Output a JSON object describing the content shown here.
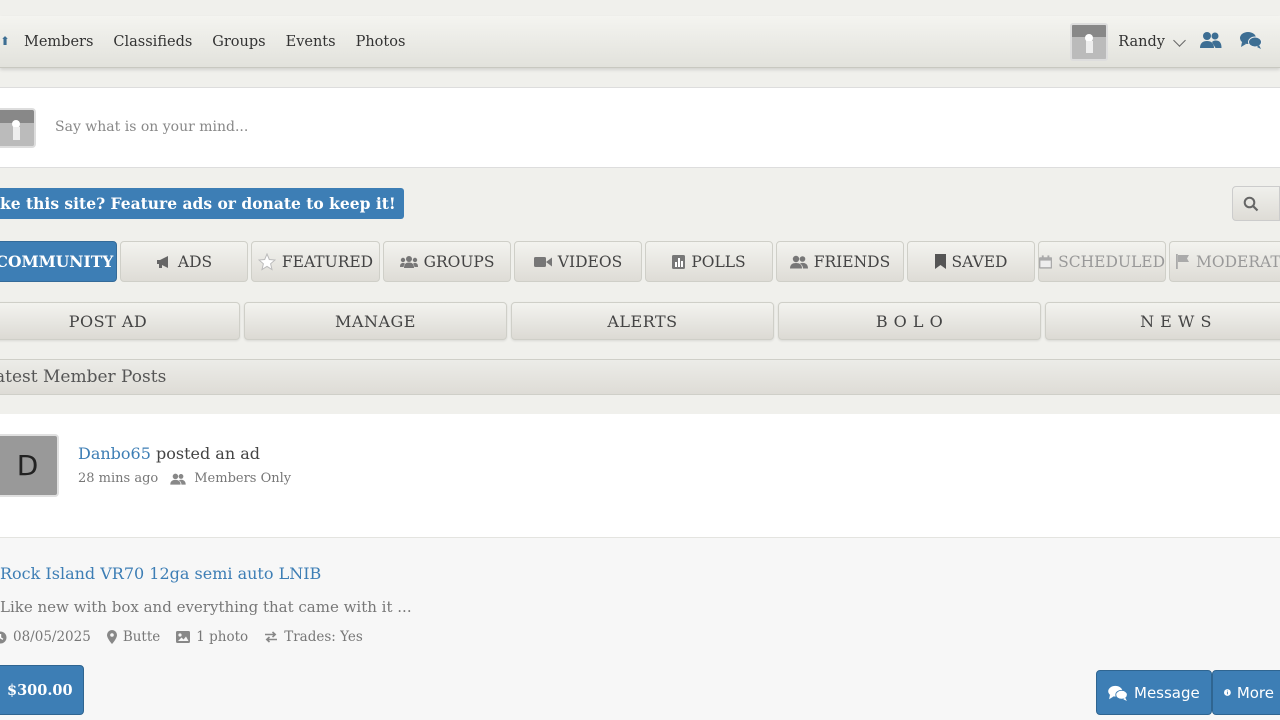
{
  "nav": {
    "links": [
      "Members",
      "Classifieds",
      "Groups",
      "Events",
      "Photos"
    ],
    "user_name": "Randy"
  },
  "composer": {
    "placeholder": "Say what is on your mind..."
  },
  "donate_banner": "ke this site? Feature ads or donate to keep it!",
  "tabs": [
    {
      "label": "COMMUNITY",
      "icon": "none",
      "active": true
    },
    {
      "label": "ADS",
      "icon": "megaphone-icon"
    },
    {
      "label": "FEATURED",
      "icon": "star-icon"
    },
    {
      "label": "GROUPS",
      "icon": "users-icon"
    },
    {
      "label": "VIDEOS",
      "icon": "video-icon"
    },
    {
      "label": "POLLS",
      "icon": "poll-icon"
    },
    {
      "label": "FRIENDS",
      "icon": "friends-icon"
    },
    {
      "label": "SAVED",
      "icon": "bookmark-icon"
    },
    {
      "label": "SCHEDULED",
      "icon": "calendar-icon"
    },
    {
      "label": "MODERATI",
      "icon": "flag-icon"
    }
  ],
  "subnav": [
    "POST AD",
    "MANAGE",
    "ALERTS",
    "B O L O",
    "N E W S"
  ],
  "section_title": "atest Member Posts",
  "post": {
    "avatar_letter": "D",
    "author": "Danbo65",
    "action": " posted an ad",
    "time": "28 mins ago",
    "visibility": "Members Only"
  },
  "ad": {
    "title": "Rock Island VR70 12ga semi auto LNIB",
    "description": "Like new with box and everything that came with it ...",
    "date": "08/05/2025",
    "location": "Butte",
    "photos": "1 photo",
    "trades": "Trades: Yes",
    "price": "$300.00",
    "message_label": "Message",
    "more_label": "More"
  },
  "colors": {
    "accent": "#3d7eb5"
  }
}
